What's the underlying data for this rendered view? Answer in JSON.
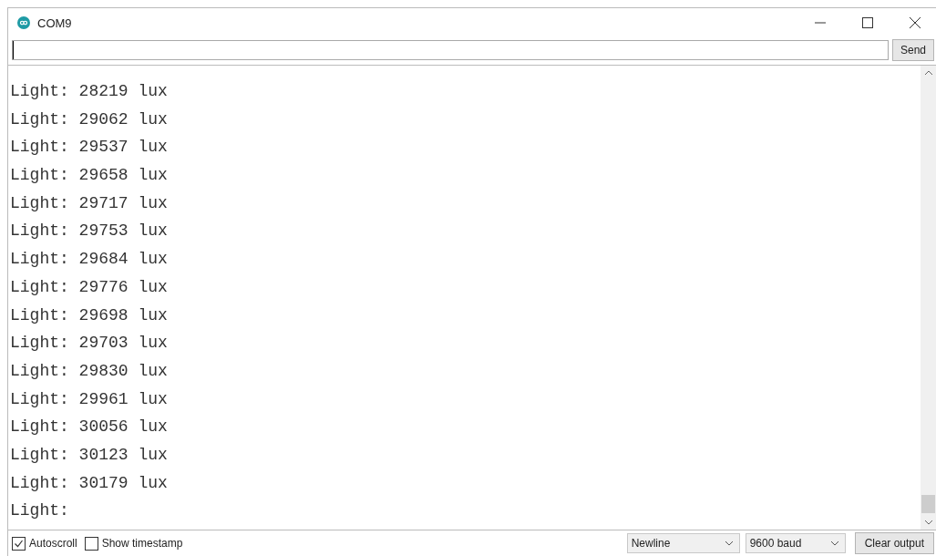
{
  "window": {
    "title": "COM9"
  },
  "send_button": "Send",
  "output_lines": [
    "Light: 28219 lux",
    "Light: 29062 lux",
    "Light: 29537 lux",
    "Light: 29658 lux",
    "Light: 29717 lux",
    "Light: 29753 lux",
    "Light: 29684 lux",
    "Light: 29776 lux",
    "Light: 29698 lux",
    "Light: 29703 lux",
    "Light: 29830 lux",
    "Light: 29961 lux",
    "Light: 30056 lux",
    "Light: 30123 lux",
    "Light: 30179 lux",
    "Light:"
  ],
  "options": [
    {
      "label": "Autoscroll",
      "checked": true
    },
    {
      "label": "Show timestamp",
      "checked": false
    }
  ],
  "line_ending": "Newline",
  "baud_rate": "9600 baud",
  "clear_button": "Clear output"
}
